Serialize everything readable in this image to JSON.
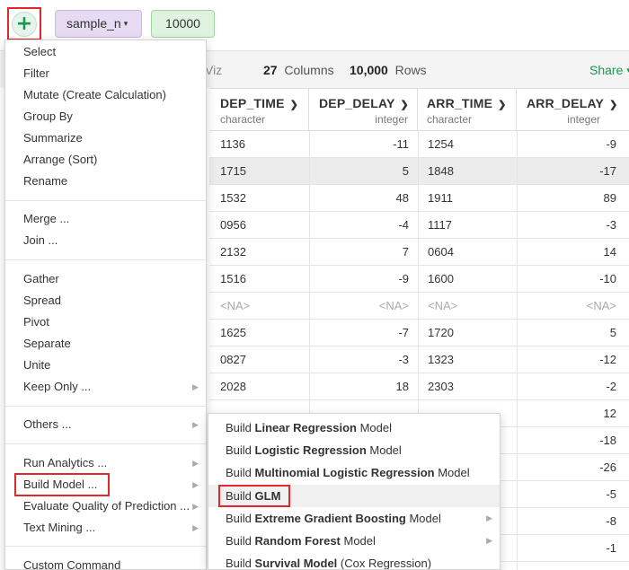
{
  "toolbar": {
    "add_symbol": "+",
    "sample_label": "sample_n",
    "sample_caret": "▾",
    "sample_value": "10000"
  },
  "stats": {
    "viz_tab": "Viz",
    "columns_count": "27",
    "columns_label": "Columns",
    "rows_count": "10,000",
    "rows_label": "Rows",
    "share_label": "Share",
    "share_caret": "▾"
  },
  "columns": [
    {
      "name": "DEP_TIME",
      "type": "character"
    },
    {
      "name": "DEP_DELAY",
      "type": "integer"
    },
    {
      "name": "ARR_TIME",
      "type": "character"
    },
    {
      "name": "ARR_DELAY",
      "type": "integer"
    }
  ],
  "rows": [
    [
      "1136",
      "-11",
      "1254",
      "-9"
    ],
    [
      "1715",
      "5",
      "1848",
      "-17"
    ],
    [
      "1532",
      "48",
      "1911",
      "89"
    ],
    [
      "0956",
      "-4",
      "1117",
      "-3"
    ],
    [
      "2132",
      "7",
      "0604",
      "14"
    ],
    [
      "1516",
      "-9",
      "1600",
      "-10"
    ],
    [
      "<NA>",
      "<NA>",
      "<NA>",
      "<NA>"
    ],
    [
      "1625",
      "-7",
      "1720",
      "5"
    ],
    [
      "0827",
      "-3",
      "1323",
      "-12"
    ],
    [
      "2028",
      "18",
      "2303",
      "-2"
    ],
    [
      "",
      "",
      "",
      "12"
    ],
    [
      "",
      "",
      "",
      "-18"
    ],
    [
      "",
      "",
      "",
      "-26"
    ],
    [
      "",
      "",
      "",
      "-5"
    ],
    [
      "",
      "",
      "",
      "-8"
    ],
    [
      "",
      "",
      "",
      "-1"
    ]
  ],
  "menu": {
    "items": [
      {
        "label": "Select"
      },
      {
        "label": "Filter"
      },
      {
        "label": "Mutate (Create Calculation)"
      },
      {
        "label": "Group By"
      },
      {
        "label": "Summarize"
      },
      {
        "label": "Arrange (Sort)"
      },
      {
        "label": "Rename"
      },
      {
        "label": "Merge ..."
      },
      {
        "label": "Join ..."
      },
      {
        "label": "Gather"
      },
      {
        "label": "Spread"
      },
      {
        "label": "Pivot"
      },
      {
        "label": "Separate"
      },
      {
        "label": "Unite"
      },
      {
        "label": "Keep Only ..."
      },
      {
        "label": "Others ..."
      },
      {
        "label": "Run Analytics ..."
      },
      {
        "label": "Build Model ..."
      },
      {
        "label": "Evaluate Quality of Prediction ..."
      },
      {
        "label": "Text Mining ..."
      },
      {
        "label": "Custom Command"
      }
    ],
    "submenu_arrow": "▶"
  },
  "submenu": {
    "items": [
      {
        "prefix": "Build ",
        "bold": "Linear Regression",
        "suffix": " Model"
      },
      {
        "prefix": "Build ",
        "bold": "Logistic Regression",
        "suffix": " Model"
      },
      {
        "prefix": "Build ",
        "bold": "Multinomial Logistic Regression",
        "suffix": " Model"
      },
      {
        "prefix": "Build ",
        "bold": "GLM",
        "suffix": ""
      },
      {
        "prefix": "Build ",
        "bold": "Extreme Gradient Boosting",
        "suffix": " Model"
      },
      {
        "prefix": "Build ",
        "bold": "Random Forest",
        "suffix": " Model"
      },
      {
        "prefix": "Build ",
        "bold": "Survival Model",
        "suffix": " (Cox Regression)"
      }
    ]
  },
  "colors": {
    "highlight_red": "#e0282d",
    "accent_green": "#1a9850",
    "sample_purple": "#e7dbf3",
    "value_green": "#dff2df"
  }
}
